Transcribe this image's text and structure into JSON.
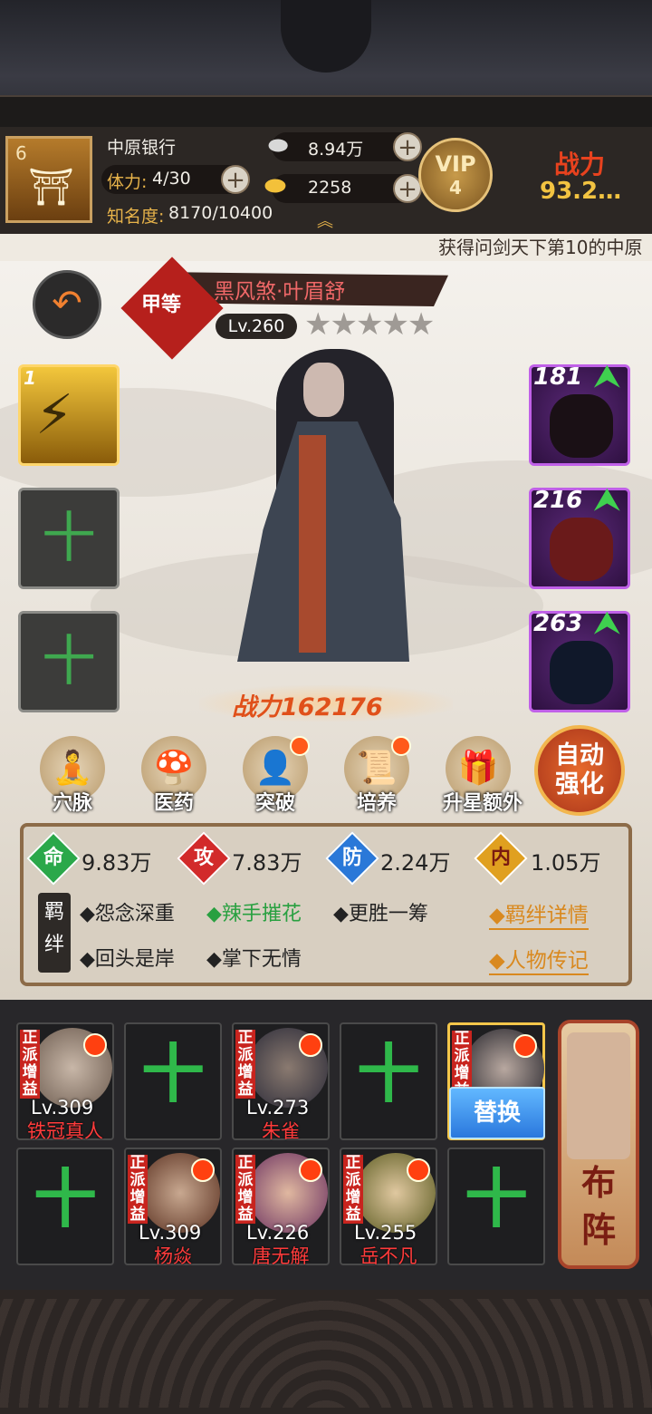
{
  "header": {
    "rank_level": "6",
    "bank_name": "中原银行",
    "stamina_label": "体力:",
    "stamina_value": "4/30",
    "fame_label": "知名度:",
    "fame_value": "8170/10400",
    "silver": "8.94万",
    "gold": "2258",
    "vip_label": "VIP",
    "vip_level": "4",
    "power_label": "战力",
    "power_value": "93.2…"
  },
  "ticker": "获得问剑天下第10的中原",
  "hero": {
    "grade": "甲等",
    "name": "黑风煞·叶眉舒",
    "level": "Lv.260",
    "stars": "★★★★★",
    "power": "战力162176"
  },
  "skill_slots": [
    {
      "level": "1",
      "state": "filled"
    },
    {
      "state": "empty",
      "plus": "十"
    },
    {
      "state": "empty",
      "plus": "十"
    }
  ],
  "equipment": [
    {
      "level": "181"
    },
    {
      "level": "216"
    },
    {
      "level": "263"
    }
  ],
  "features": [
    {
      "label": "穴脉",
      "icon": "meditation-icon",
      "dot": false
    },
    {
      "label": "医药",
      "icon": "herb-icon",
      "dot": false
    },
    {
      "label": "突破",
      "icon": "breakthrough-icon",
      "dot": true
    },
    {
      "label": "培养",
      "icon": "scroll-icon",
      "dot": true
    },
    {
      "label": "升星额外",
      "icon": "star-up-icon",
      "dot": false
    }
  ],
  "auto_enhance": {
    "line1": "自动",
    "line2": "强化"
  },
  "stats": {
    "hp": {
      "char": "命",
      "value": "9.83万",
      "color": "#2aa84a"
    },
    "atk": {
      "char": "攻",
      "value": "7.83万",
      "color": "#d22a2a"
    },
    "def": {
      "char": "防",
      "value": "2.24万",
      "color": "#2a78d8"
    },
    "inner": {
      "char": "内",
      "value": "1.05万",
      "color": "#e0a020"
    }
  },
  "bonds": {
    "tag_line1": "羁",
    "tag_line2": "绊",
    "row1": [
      "◆怨念深重",
      "◆辣手摧花",
      "◆更胜一筹"
    ],
    "row2": [
      "◆回头是岸",
      "◆掌下无情"
    ],
    "detail_link": "◆羁绊详情",
    "bio_link": "◆人物传记"
  },
  "formation": {
    "tag": "正派增益",
    "plus": "十",
    "swap": "替换",
    "arrange": [
      "布",
      "阵"
    ],
    "slots": [
      {
        "level": "Lv.309",
        "name": "铁冠真人",
        "state": "filled"
      },
      {
        "state": "empty"
      },
      {
        "level": "Lv.273",
        "name": "朱雀",
        "state": "filled"
      },
      {
        "state": "empty"
      },
      {
        "state": "active"
      },
      {
        "state": "empty"
      },
      {
        "level": "Lv.309",
        "name": "杨焱",
        "state": "filled"
      },
      {
        "level": "Lv.226",
        "name": "唐无解",
        "state": "filled"
      },
      {
        "level": "Lv.255",
        "name": "岳不凡",
        "state": "filled"
      },
      {
        "state": "empty"
      }
    ]
  }
}
